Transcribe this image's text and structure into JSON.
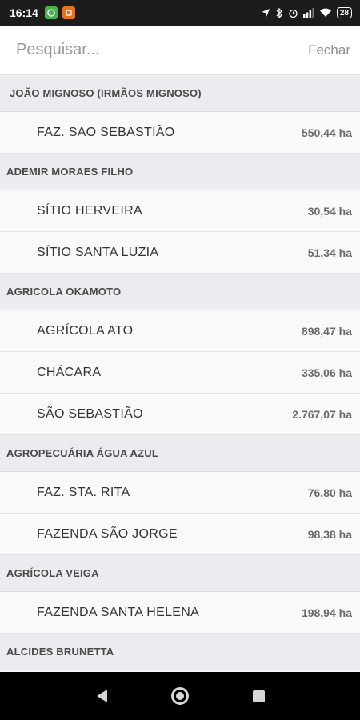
{
  "status_bar": {
    "time": "16:14",
    "battery": "28",
    "icons": [
      "whatsapp-icon",
      "app-notification-icon",
      "location-icon",
      "bluetooth-icon",
      "alarm-icon",
      "signal-icon",
      "wifi-icon",
      "battery-icon"
    ]
  },
  "search": {
    "placeholder": "Pesquisar...",
    "value": "",
    "close_label": "Fechar"
  },
  "groups": [
    {
      "name": "JOÃO MIGNOSO (IRMÃOS MIGNOSO)",
      "items": [
        {
          "name": "FAZ. SAO SEBASTIÃO",
          "area": "550,44 ha"
        }
      ]
    },
    {
      "name": "ADEMIR MORAES FILHO",
      "items": [
        {
          "name": "SÍTIO HERVEIRA",
          "area": "30,54 ha"
        },
        {
          "name": "SÍTIO SANTA LUZIA",
          "area": "51,34 ha"
        }
      ]
    },
    {
      "name": "AGRICOLA OKAMOTO",
      "items": [
        {
          "name": "AGRÍCOLA ATO",
          "area": "898,47 ha"
        },
        {
          "name": "CHÁCARA",
          "area": "335,06 ha"
        },
        {
          "name": "SÃO SEBASTIÃO",
          "area": "2.767,07 ha"
        }
      ]
    },
    {
      "name": "AGROPECUÁRIA ÁGUA AZUL",
      "items": [
        {
          "name": "FAZ. STA. RITA",
          "area": "76,80 ha"
        },
        {
          "name": "FAZENDA SÃO JORGE",
          "area": "98,38 ha"
        }
      ]
    },
    {
      "name": "AGRÍCOLA VEIGA",
      "items": [
        {
          "name": "FAZENDA SANTA HELENA",
          "area": "198,94 ha"
        }
      ]
    },
    {
      "name": "ALCIDES BRUNETTA",
      "items": []
    }
  ],
  "nav_bar": {
    "icons": [
      "back-icon",
      "home-icon",
      "recents-icon"
    ]
  }
}
